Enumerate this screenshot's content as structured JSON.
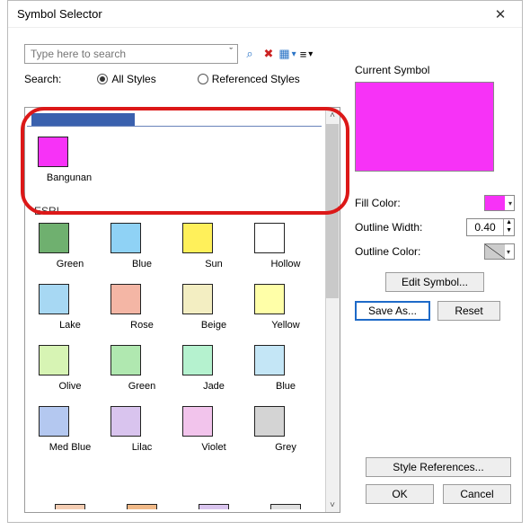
{
  "window": {
    "title": "Symbol Selector"
  },
  "search": {
    "placeholder": "Type here to search",
    "label": "Search:",
    "all_styles": "All Styles",
    "referenced": "Referenced Styles"
  },
  "group1": {
    "items": [
      {
        "name": "Bangunan",
        "color": "#f732f7"
      }
    ]
  },
  "group2_label": "ESRI",
  "swatches": [
    {
      "name": "Green",
      "color": "#6fb06f"
    },
    {
      "name": "Blue",
      "color": "#8fd2f5"
    },
    {
      "name": "Sun",
      "color": "#fff05a"
    },
    {
      "name": "Hollow",
      "color": "#ffffff"
    },
    {
      "name": "Lake",
      "color": "#a7d8f3"
    },
    {
      "name": "Rose",
      "color": "#f4b6a5"
    },
    {
      "name": "Beige",
      "color": "#f3eec2"
    },
    {
      "name": "Yellow",
      "color": "#ffffa8"
    },
    {
      "name": "Olive",
      "color": "#d7f4b4"
    },
    {
      "name": "Green",
      "color": "#b0e8b0"
    },
    {
      "name": "Jade",
      "color": "#b5f2cf"
    },
    {
      "name": "Blue",
      "color": "#c4e6f6"
    },
    {
      "name": "Med Blue",
      "color": "#b4c8f0"
    },
    {
      "name": "Lilac",
      "color": "#d9c4ee"
    },
    {
      "name": "Violet",
      "color": "#f2c4ec"
    },
    {
      "name": "Grey",
      "color": "#d4d4d4"
    }
  ],
  "partial_colors": [
    "#f4cdb3",
    "#f0b988",
    "#d9c4ee",
    "#e0e0e0"
  ],
  "panel": {
    "current": "Current Symbol",
    "fill_label": "Fill Color:",
    "fill_color": "#f732f7",
    "owidth_label": "Outline Width:",
    "owidth_value": "0.40",
    "ocolor_label": "Outline Color:",
    "edit": "Edit Symbol...",
    "saveas": "Save As...",
    "reset": "Reset",
    "style_refs": "Style References...",
    "ok": "OK",
    "cancel": "Cancel"
  }
}
